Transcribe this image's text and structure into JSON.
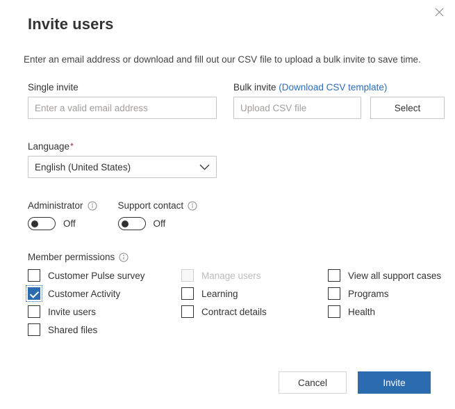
{
  "dialog": {
    "title": "Invite users",
    "subtitle": "Enter an email address or download and fill out our CSV file to upload a bulk invite to save time.",
    "close_icon": "close-icon"
  },
  "single_invite": {
    "label": "Single invite",
    "placeholder": "Enter a valid email address",
    "value": ""
  },
  "bulk_invite": {
    "label": "Bulk invite",
    "link_label": "(Download CSV template)",
    "placeholder": "Upload CSV file",
    "value": "",
    "select_button": "Select"
  },
  "language": {
    "label": "Language",
    "required_marker": "*",
    "selected": "English (United States)",
    "chevron_icon": "chevron-down-icon"
  },
  "toggles": [
    {
      "label": "Administrator",
      "state": "Off",
      "checked": false,
      "info_icon": "info-icon"
    },
    {
      "label": "Support contact",
      "state": "Off",
      "checked": false,
      "info_icon": "info-icon"
    }
  ],
  "member_permissions": {
    "title": "Member permissions",
    "info_icon": "info-icon",
    "items": [
      {
        "label": "Customer Pulse survey",
        "checked": false,
        "disabled": false,
        "focused": false
      },
      {
        "label": "Manage users",
        "checked": false,
        "disabled": true,
        "focused": false
      },
      {
        "label": "View all support cases",
        "checked": false,
        "disabled": false,
        "focused": false
      },
      {
        "label": "Customer Activity",
        "checked": true,
        "disabled": false,
        "focused": true
      },
      {
        "label": "Learning",
        "checked": false,
        "disabled": false,
        "focused": false
      },
      {
        "label": "Programs",
        "checked": false,
        "disabled": false,
        "focused": false
      },
      {
        "label": "Invite users",
        "checked": false,
        "disabled": false,
        "focused": false
      },
      {
        "label": "Contract details",
        "checked": false,
        "disabled": false,
        "focused": false
      },
      {
        "label": "Health",
        "checked": false,
        "disabled": false,
        "focused": false
      },
      {
        "label": "Shared files",
        "checked": false,
        "disabled": false,
        "focused": false
      }
    ]
  },
  "footer": {
    "cancel_label": "Cancel",
    "invite_label": "Invite"
  },
  "colors": {
    "accent": "#2b6cb0",
    "link": "#2a6ebb",
    "required": "#a4262c",
    "border": "#c8c6c4",
    "text": "#333333",
    "placeholder": "#a19f9d",
    "disabled_text": "#bcbcbc"
  }
}
